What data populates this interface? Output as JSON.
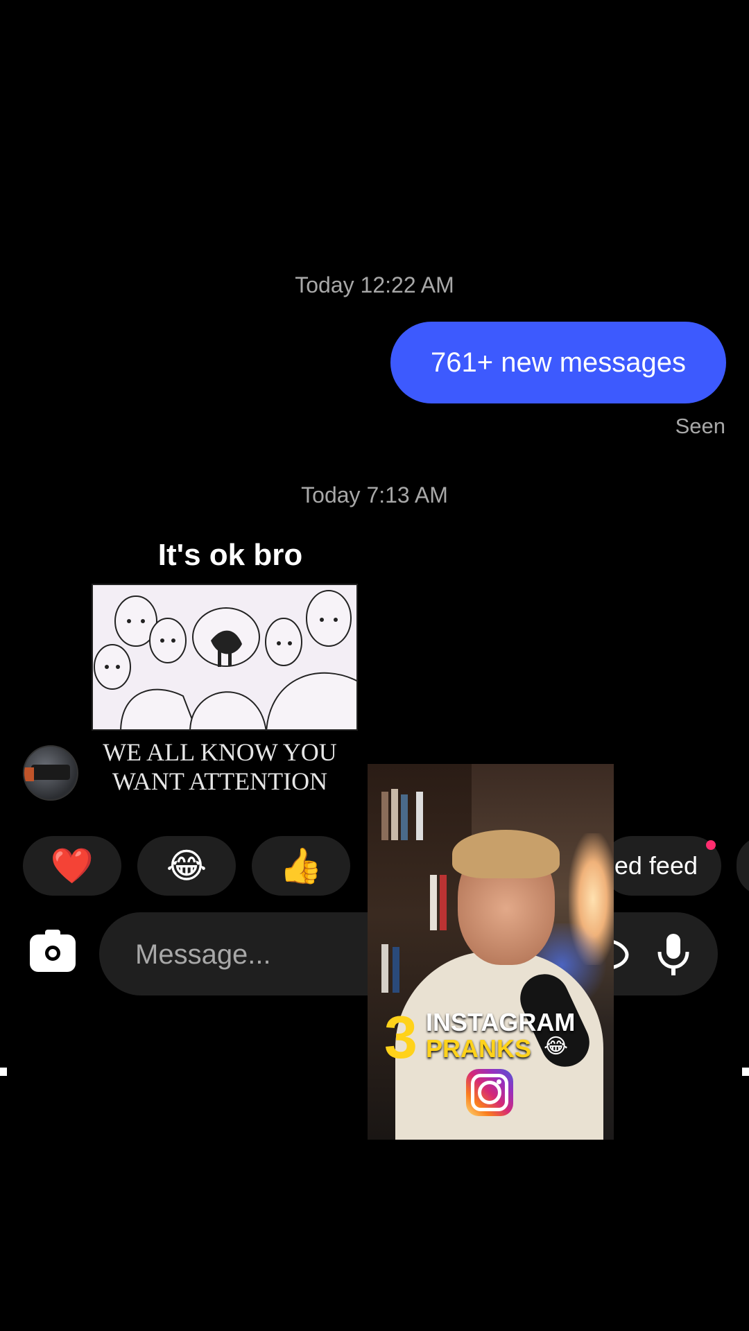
{
  "chat": {
    "timestamp_1": "Today 12:22 AM",
    "sent_message": "761+ new messages",
    "seen_label": "Seen",
    "timestamp_2": "Today 7:13 AM",
    "meme": {
      "caption_top": "It's ok bro",
      "caption_bottom_line1": "WE ALL KNOW YOU",
      "caption_bottom_line2": "WANT ATTENTION"
    }
  },
  "quick_reactions": {
    "heart": "❤️",
    "laugh": "😂",
    "thumbs_up": "👍",
    "partial_label": "ed feed"
  },
  "composer": {
    "placeholder": "Message..."
  },
  "video_overlay": {
    "number": "3",
    "line1": "INSTAGRAM",
    "line2": "PRANKS",
    "emoji": "😂"
  },
  "colors": {
    "sent_bubble": "#3d5afe",
    "background": "#000000",
    "pill": "#1f1f1f",
    "accent_yellow": "#ffd21a",
    "notification_dot": "#ff2d6f"
  },
  "icons": [
    "camera-icon",
    "mic-icon",
    "instagram-logo-icon"
  ]
}
